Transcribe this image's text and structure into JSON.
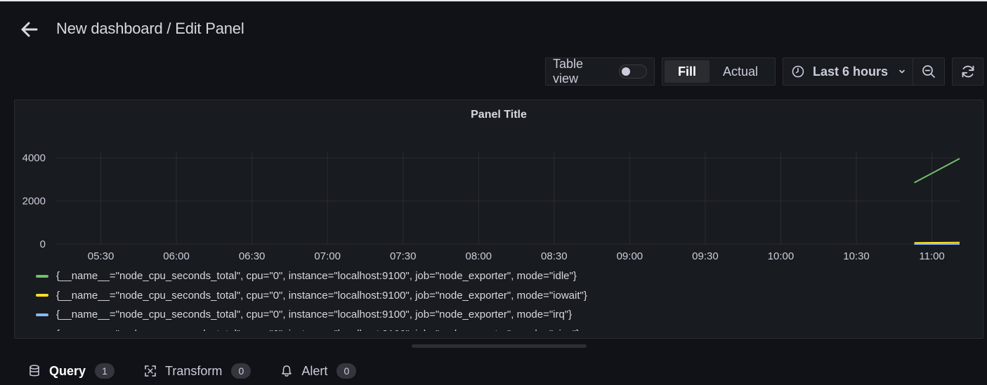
{
  "header": {
    "title": "New dashboard / Edit Panel"
  },
  "toolbar": {
    "table_view_label": "Table view",
    "table_view_enabled": false,
    "fill_label": "Fill",
    "actual_label": "Actual",
    "time_range_label": "Last 6 hours"
  },
  "panel": {
    "title": "Panel Title",
    "legend": [
      {
        "label": "{__name__=\"node_cpu_seconds_total\", cpu=\"0\", instance=\"localhost:9100\", job=\"node_exporter\", mode=\"idle\"}",
        "color": "#73bf69"
      },
      {
        "label": "{__name__=\"node_cpu_seconds_total\", cpu=\"0\", instance=\"localhost:9100\", job=\"node_exporter\", mode=\"iowait\"}",
        "color": "#fade2a"
      },
      {
        "label": "{__name__=\"node_cpu_seconds_total\", cpu=\"0\", instance=\"localhost:9100\", job=\"node_exporter\", mode=\"irq\"}",
        "color": "#8ab8ff"
      },
      {
        "label": "{__name__=\"node_cpu_seconds_total\", cpu=\"0\", instance=\"localhost:9100\", job=\"node_exporter\", mode=\"nice\"}",
        "color": "#ff780a"
      }
    ]
  },
  "chart_data": {
    "type": "line",
    "title": "Panel Title",
    "xlabel": "",
    "ylabel": "",
    "x_ticks": [
      "05:30",
      "06:00",
      "06:30",
      "07:00",
      "07:30",
      "08:00",
      "08:30",
      "09:00",
      "09:30",
      "10:00",
      "10:30",
      "11:00"
    ],
    "y_ticks": [
      0,
      2000,
      4000
    ],
    "xlim": [
      "05:12",
      "11:11"
    ],
    "ylim": [
      0,
      4300
    ],
    "grid": true,
    "legend_position": "bottom",
    "series": [
      {
        "name": "{__name__=\"node_cpu_seconds_total\", cpu=\"0\", instance=\"localhost:9100\", job=\"node_exporter\", mode=\"idle\"}",
        "color": "#73bf69",
        "x": [
          "10:53",
          "11:11"
        ],
        "y": [
          2850,
          3970
        ]
      },
      {
        "name": "{__name__=\"node_cpu_seconds_total\", cpu=\"0\", instance=\"localhost:9100\", job=\"node_exporter\", mode=\"iowait\"}",
        "color": "#fade2a",
        "x": [
          "10:53",
          "11:11"
        ],
        "y": [
          55,
          75
        ]
      },
      {
        "name": "{__name__=\"node_cpu_seconds_total\", cpu=\"0\", instance=\"localhost:9100\", job=\"node_exporter\", mode=\"irq\"}",
        "color": "#8ab8ff",
        "x": [
          "10:53",
          "11:11"
        ],
        "y": [
          0,
          0
        ]
      }
    ]
  },
  "tabs": [
    {
      "label": "Query",
      "count": "1",
      "active": true
    },
    {
      "label": "Transform",
      "count": "0",
      "active": false
    },
    {
      "label": "Alert",
      "count": "0",
      "active": false
    }
  ]
}
